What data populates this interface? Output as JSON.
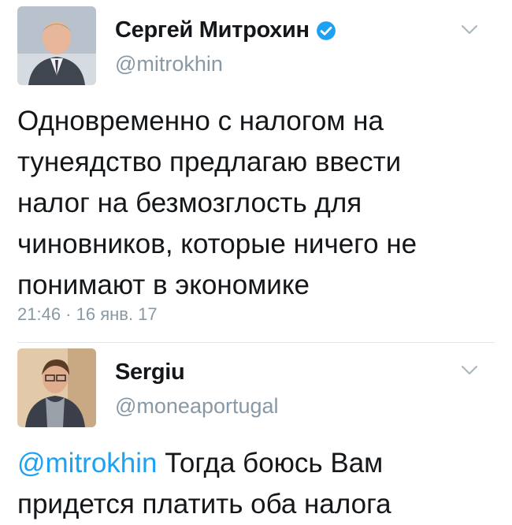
{
  "tweets": [
    {
      "display_name": "Сергей Митрохин",
      "handle": "@mitrokhin",
      "verified": true,
      "text": "Одновременно с налогом на тунеядство предлагаю ввести налог на безмозглость для чиновников, которые ничего не понимают в экономике",
      "timestamp": "21:46 · 16 янв. 17",
      "avatar_icon": "person-avatar"
    },
    {
      "display_name": "Sergiu",
      "handle": "@moneaportugal",
      "verified": false,
      "mention": "@mitrokhin",
      "text": " Тогда боюсь Вам придется платить оба налога",
      "avatar_icon": "person-avatar"
    }
  ],
  "colors": {
    "accent": "#1da1f2",
    "muted": "#8899a6",
    "text": "#14171a",
    "divider": "#e1e8ed"
  },
  "icons": {
    "menu": "chevron-down-icon",
    "verified": "verified-badge-icon"
  }
}
